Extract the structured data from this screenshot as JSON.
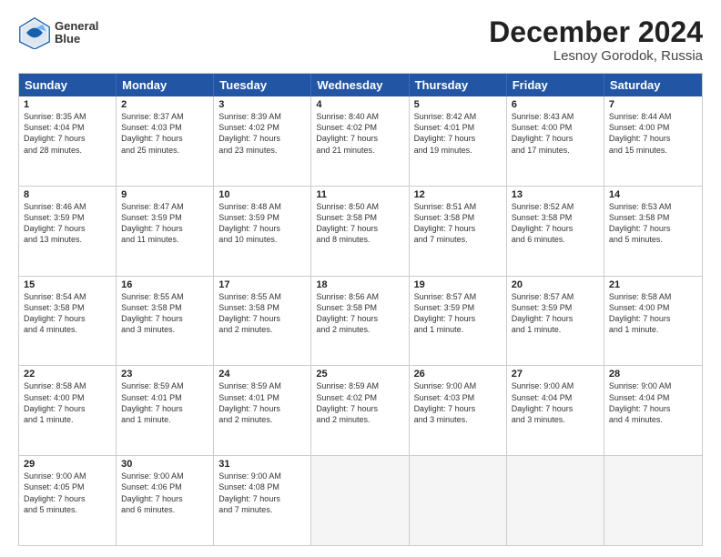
{
  "header": {
    "logo_line1": "General",
    "logo_line2": "Blue",
    "month": "December 2024",
    "location": "Lesnoy Gorodok, Russia"
  },
  "days_of_week": [
    "Sunday",
    "Monday",
    "Tuesday",
    "Wednesday",
    "Thursday",
    "Friday",
    "Saturday"
  ],
  "weeks": [
    [
      {
        "day": "1",
        "text": "Sunrise: 8:35 AM\nSunset: 4:04 PM\nDaylight: 7 hours\nand 28 minutes."
      },
      {
        "day": "2",
        "text": "Sunrise: 8:37 AM\nSunset: 4:03 PM\nDaylight: 7 hours\nand 25 minutes."
      },
      {
        "day": "3",
        "text": "Sunrise: 8:39 AM\nSunset: 4:02 PM\nDaylight: 7 hours\nand 23 minutes."
      },
      {
        "day": "4",
        "text": "Sunrise: 8:40 AM\nSunset: 4:02 PM\nDaylight: 7 hours\nand 21 minutes."
      },
      {
        "day": "5",
        "text": "Sunrise: 8:42 AM\nSunset: 4:01 PM\nDaylight: 7 hours\nand 19 minutes."
      },
      {
        "day": "6",
        "text": "Sunrise: 8:43 AM\nSunset: 4:00 PM\nDaylight: 7 hours\nand 17 minutes."
      },
      {
        "day": "7",
        "text": "Sunrise: 8:44 AM\nSunset: 4:00 PM\nDaylight: 7 hours\nand 15 minutes."
      }
    ],
    [
      {
        "day": "8",
        "text": "Sunrise: 8:46 AM\nSunset: 3:59 PM\nDaylight: 7 hours\nand 13 minutes."
      },
      {
        "day": "9",
        "text": "Sunrise: 8:47 AM\nSunset: 3:59 PM\nDaylight: 7 hours\nand 11 minutes."
      },
      {
        "day": "10",
        "text": "Sunrise: 8:48 AM\nSunset: 3:59 PM\nDaylight: 7 hours\nand 10 minutes."
      },
      {
        "day": "11",
        "text": "Sunrise: 8:50 AM\nSunset: 3:58 PM\nDaylight: 7 hours\nand 8 minutes."
      },
      {
        "day": "12",
        "text": "Sunrise: 8:51 AM\nSunset: 3:58 PM\nDaylight: 7 hours\nand 7 minutes."
      },
      {
        "day": "13",
        "text": "Sunrise: 8:52 AM\nSunset: 3:58 PM\nDaylight: 7 hours\nand 6 minutes."
      },
      {
        "day": "14",
        "text": "Sunrise: 8:53 AM\nSunset: 3:58 PM\nDaylight: 7 hours\nand 5 minutes."
      }
    ],
    [
      {
        "day": "15",
        "text": "Sunrise: 8:54 AM\nSunset: 3:58 PM\nDaylight: 7 hours\nand 4 minutes."
      },
      {
        "day": "16",
        "text": "Sunrise: 8:55 AM\nSunset: 3:58 PM\nDaylight: 7 hours\nand 3 minutes."
      },
      {
        "day": "17",
        "text": "Sunrise: 8:55 AM\nSunset: 3:58 PM\nDaylight: 7 hours\nand 2 minutes."
      },
      {
        "day": "18",
        "text": "Sunrise: 8:56 AM\nSunset: 3:58 PM\nDaylight: 7 hours\nand 2 minutes."
      },
      {
        "day": "19",
        "text": "Sunrise: 8:57 AM\nSunset: 3:59 PM\nDaylight: 7 hours\nand 1 minute."
      },
      {
        "day": "20",
        "text": "Sunrise: 8:57 AM\nSunset: 3:59 PM\nDaylight: 7 hours\nand 1 minute."
      },
      {
        "day": "21",
        "text": "Sunrise: 8:58 AM\nSunset: 4:00 PM\nDaylight: 7 hours\nand 1 minute."
      }
    ],
    [
      {
        "day": "22",
        "text": "Sunrise: 8:58 AM\nSunset: 4:00 PM\nDaylight: 7 hours\nand 1 minute."
      },
      {
        "day": "23",
        "text": "Sunrise: 8:59 AM\nSunset: 4:01 PM\nDaylight: 7 hours\nand 1 minute."
      },
      {
        "day": "24",
        "text": "Sunrise: 8:59 AM\nSunset: 4:01 PM\nDaylight: 7 hours\nand 2 minutes."
      },
      {
        "day": "25",
        "text": "Sunrise: 8:59 AM\nSunset: 4:02 PM\nDaylight: 7 hours\nand 2 minutes."
      },
      {
        "day": "26",
        "text": "Sunrise: 9:00 AM\nSunset: 4:03 PM\nDaylight: 7 hours\nand 3 minutes."
      },
      {
        "day": "27",
        "text": "Sunrise: 9:00 AM\nSunset: 4:04 PM\nDaylight: 7 hours\nand 3 minutes."
      },
      {
        "day": "28",
        "text": "Sunrise: 9:00 AM\nSunset: 4:04 PM\nDaylight: 7 hours\nand 4 minutes."
      }
    ],
    [
      {
        "day": "29",
        "text": "Sunrise: 9:00 AM\nSunset: 4:05 PM\nDaylight: 7 hours\nand 5 minutes."
      },
      {
        "day": "30",
        "text": "Sunrise: 9:00 AM\nSunset: 4:06 PM\nDaylight: 7 hours\nand 6 minutes."
      },
      {
        "day": "31",
        "text": "Sunrise: 9:00 AM\nSunset: 4:08 PM\nDaylight: 7 hours\nand 7 minutes."
      },
      {
        "day": "",
        "text": ""
      },
      {
        "day": "",
        "text": ""
      },
      {
        "day": "",
        "text": ""
      },
      {
        "day": "",
        "text": ""
      }
    ]
  ]
}
